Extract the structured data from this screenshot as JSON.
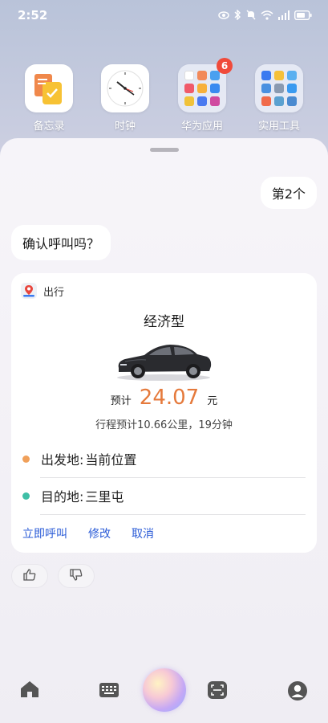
{
  "status_bar": {
    "time": "2:52"
  },
  "home_apps": [
    {
      "label": "备忘录"
    },
    {
      "label": "时钟"
    },
    {
      "label": "华为应用",
      "badge": "6"
    },
    {
      "label": "实用工具"
    }
  ],
  "chat": {
    "user_message": "第2个",
    "bot_message": "确认呼叫吗？"
  },
  "card": {
    "app_name": "出行",
    "car_type": "经济型",
    "fare_prefix": "预计",
    "fare_value": "24.07",
    "fare_unit": "元",
    "trip_info": "行程预计10.66公里，19分钟",
    "from_label": "出发地:",
    "from_value": "当前位置",
    "to_label": "目的地:",
    "to_value": "三里屯",
    "actions": {
      "call": "立即呼叫",
      "modify": "修改",
      "cancel": "取消"
    }
  },
  "colors": {
    "accent": "#2a5bd7",
    "fare": "#e57a3c",
    "from_dot": "#f0a05a",
    "to_dot": "#3fbfa6",
    "badge": "#f04a3a"
  },
  "icons": {
    "status": [
      "eye-icon",
      "bluetooth-icon",
      "mute-icon",
      "wifi-icon",
      "signal-icon",
      "battery-icon"
    ],
    "dock": [
      "home-icon",
      "keyboard-icon",
      "assistant-orb",
      "scan-icon",
      "profile-icon"
    ],
    "feedback": [
      "thumbs-up-icon",
      "thumbs-down-icon"
    ]
  }
}
